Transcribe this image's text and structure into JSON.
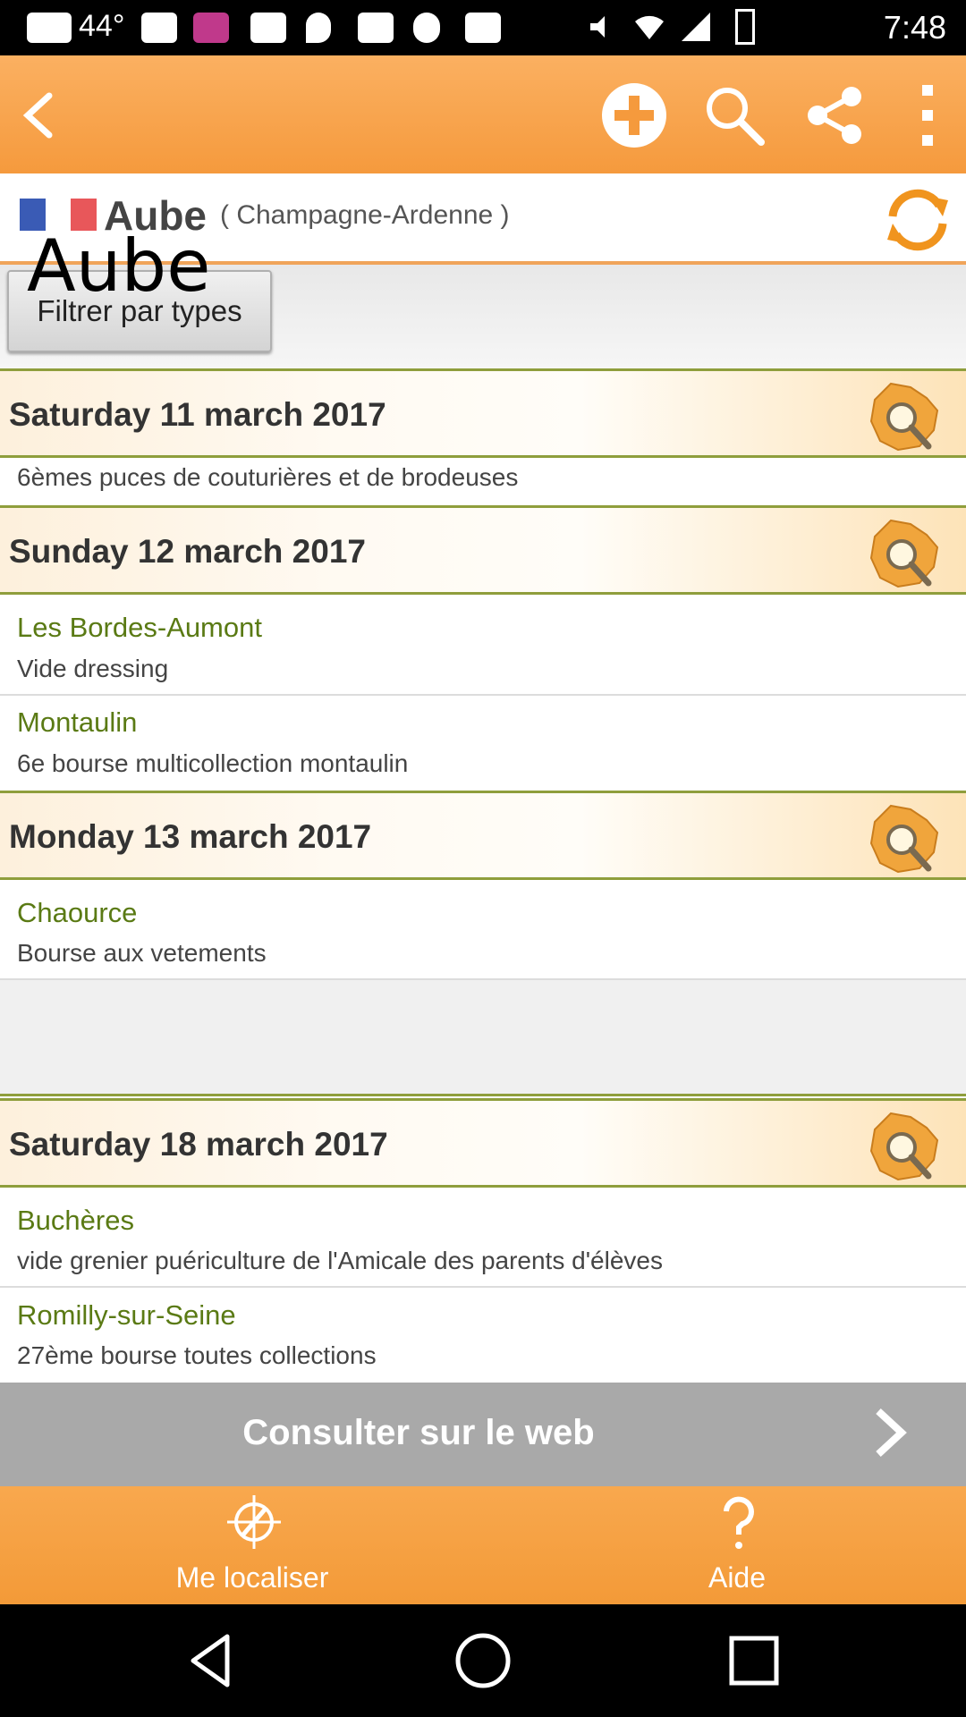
{
  "status_bar": {
    "temperature": "44°",
    "time": "7:48"
  },
  "action_bar": {
    "back_icon": "chevron-left-icon",
    "add_icon": "plus-circle-icon",
    "search_icon": "search-icon",
    "share_icon": "share-icon",
    "menu_icon": "more-vert-icon"
  },
  "header": {
    "region_name": "Aube",
    "parent_region": "( Champagne-Ardenne )",
    "overlay_title": "Aube",
    "filter_button": "Filtrer par types",
    "flag_colors": [
      "#3a5bb5",
      "#ffffff",
      "#e8575a"
    ]
  },
  "days": [
    {
      "date": "Saturday 11 march 2017",
      "events": [
        {
          "place": "",
          "desc": "6èmes puces de couturières et de brodeuses"
        }
      ]
    },
    {
      "date": "Sunday 12 march 2017",
      "events": [
        {
          "place": "Les Bordes-Aumont",
          "desc": "Vide dressing"
        },
        {
          "place": "Montaulin",
          "desc": "6e bourse multicollection montaulin"
        }
      ]
    },
    {
      "date": "Monday 13 march 2017",
      "events": [
        {
          "place": "Chaource",
          "desc": "Bourse aux vetements"
        }
      ]
    },
    {
      "date": "Saturday 18 march 2017",
      "events": [
        {
          "place": "Buchères",
          "desc": "vide grenier puériculture de l'Amicale des parents d'élèves"
        },
        {
          "place": "Romilly-sur-Seine",
          "desc": "27ème bourse toutes collections"
        }
      ]
    }
  ],
  "web_button": {
    "label": "Consulter sur le web"
  },
  "bottom_bar": {
    "locate_label": "Me localiser",
    "help_label": "Aide"
  },
  "colors": {
    "accent": "#f59a3d",
    "place_text": "#5a7a14",
    "divider": "#8f9e3c"
  }
}
